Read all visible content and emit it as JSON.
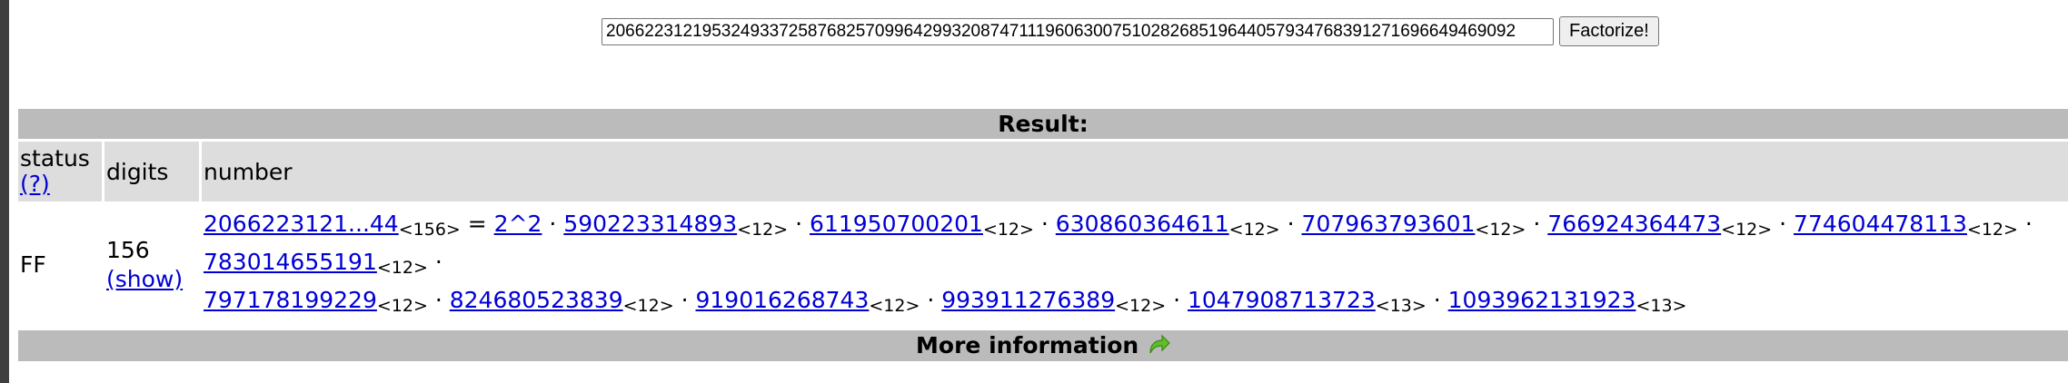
{
  "search": {
    "value": "20662231219532493372587682570996429932087471119606300751028268519644057934768391271696649469092",
    "button_label": "Factorize!"
  },
  "result": {
    "header": "Result:",
    "columns": {
      "status": "status",
      "status_help": "(?)",
      "digits": "digits",
      "number": "number"
    },
    "row": {
      "status": "FF",
      "digits": "156",
      "show_link": "(show)",
      "number_short": "2066223121...44",
      "number_len": "<156>",
      "equals": " = ",
      "factor_2": "2^2",
      "factors_line1": [
        {
          "value": "590223314893",
          "len": "<12>"
        },
        {
          "value": "611950700201",
          "len": "<12>"
        },
        {
          "value": "630860364611",
          "len": "<12>"
        },
        {
          "value": "707963793601",
          "len": "<12>"
        },
        {
          "value": "766924364473",
          "len": "<12>"
        },
        {
          "value": "774604478113",
          "len": "<12>"
        },
        {
          "value": "783014655191",
          "len": "<12>"
        }
      ],
      "factors_line2": [
        {
          "value": "797178199229",
          "len": "<12>"
        },
        {
          "value": "824680523839",
          "len": "<12>"
        },
        {
          "value": "919016268743",
          "len": "<12>"
        },
        {
          "value": "993911276389",
          "len": "<12>"
        },
        {
          "value": "1047908713723",
          "len": "<13>"
        },
        {
          "value": "1093962131923",
          "len": "<13>"
        }
      ]
    }
  },
  "more_info": {
    "label": "More information",
    "icon": "green-arrow-icon"
  }
}
